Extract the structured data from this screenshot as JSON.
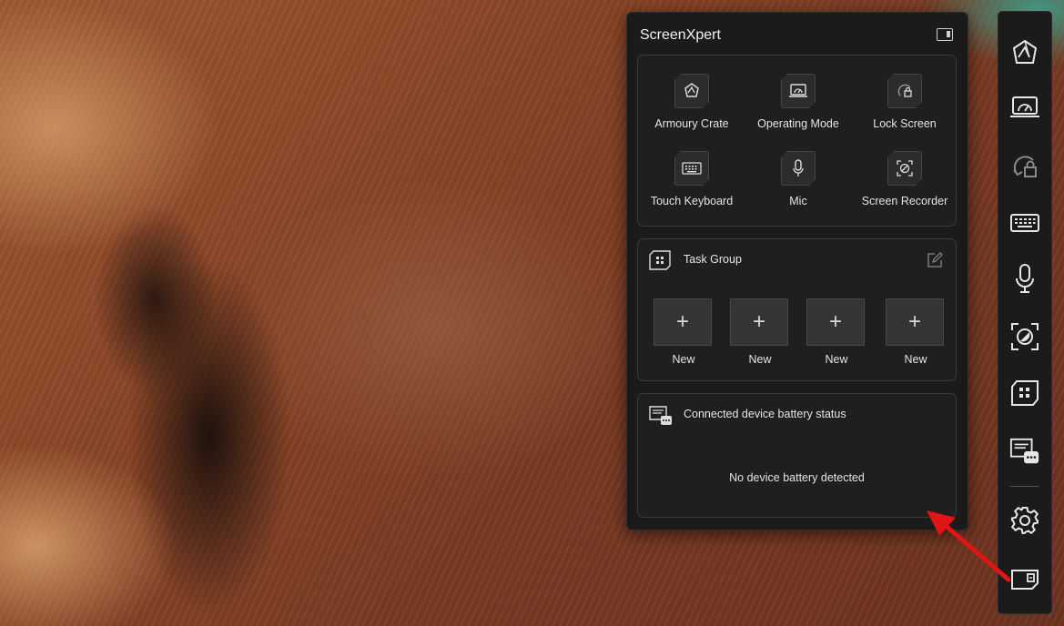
{
  "panel": {
    "title": "ScreenXpert"
  },
  "quick_actions": [
    {
      "label": "Armoury Crate",
      "icon": "armoury-crate-icon"
    },
    {
      "label": "Operating Mode",
      "icon": "operating-mode-icon"
    },
    {
      "label": "Lock Screen",
      "icon": "lock-screen-icon"
    },
    {
      "label": "Touch Keyboard",
      "icon": "keyboard-icon"
    },
    {
      "label": "Mic",
      "icon": "mic-icon"
    },
    {
      "label": "Screen Recorder",
      "icon": "screen-recorder-icon"
    }
  ],
  "task_group": {
    "title": "Task Group",
    "slots": [
      {
        "label": "New"
      },
      {
        "label": "New"
      },
      {
        "label": "New"
      },
      {
        "label": "New"
      }
    ]
  },
  "battery": {
    "title": "Connected device battery status",
    "empty_message": "No device battery detected"
  },
  "dock": {
    "items": [
      "armoury-crate-icon",
      "operating-mode-icon",
      "lock-screen-icon",
      "keyboard-icon",
      "mic-icon",
      "screen-recorder-icon",
      "task-group-icon",
      "battery-status-icon",
      "settings-icon",
      "panel-toggle-icon"
    ]
  },
  "colors": {
    "panel_bg": "#1b1b1b",
    "card_bg": "#1f1f1f",
    "text": "#e8e8e8",
    "annotation_arrow": "#e01515"
  }
}
